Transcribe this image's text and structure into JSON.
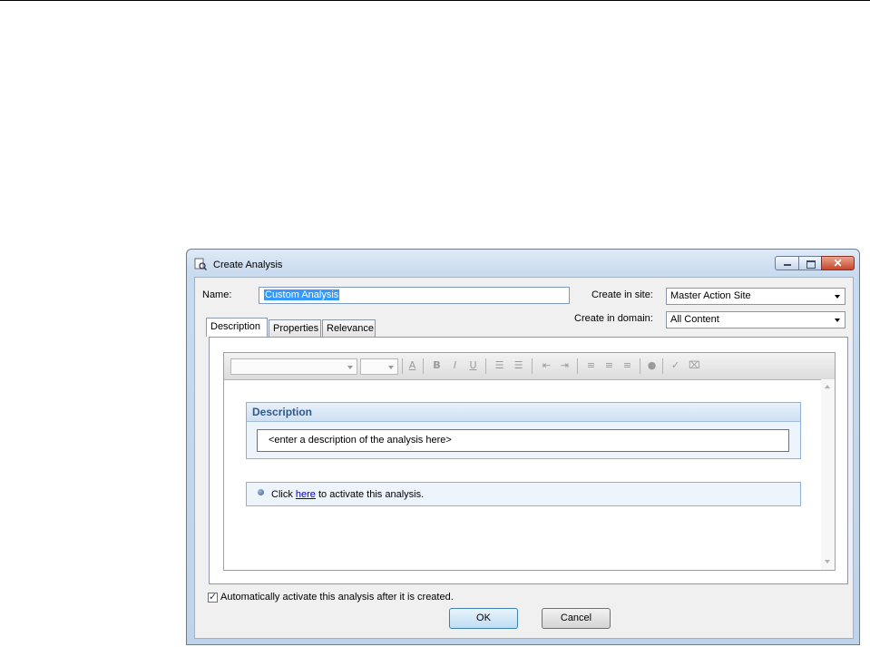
{
  "window": {
    "title": "Create Analysis",
    "close_glyph": "✕"
  },
  "form": {
    "name_label": "Name:",
    "name_value": "Custom Analysis",
    "site_label": "Create in site:",
    "site_value": "Master Action Site",
    "domain_label": "Create in domain:",
    "domain_value": "All Content"
  },
  "tabs": [
    {
      "label": "Description",
      "active": true
    },
    {
      "label": "Properties",
      "active": false
    },
    {
      "label": "Relevance",
      "active": false
    }
  ],
  "toolbar": {
    "icons": [
      "font-color-icon",
      "bold-icon",
      "italic-icon",
      "underline-icon",
      "numbered-list-icon",
      "bullet-list-icon",
      "outdent-icon",
      "indent-icon",
      "align-left-icon",
      "align-center-icon",
      "align-right-icon",
      "link-icon",
      "spellcheck-icon",
      "clear-format-icon"
    ],
    "glyphs": {
      "font_color": "A",
      "bold": "B",
      "italic": "I",
      "underline": "U",
      "numbered_list": "☰",
      "bullet_list": "☰",
      "outdent": "⇤",
      "indent": "⇥",
      "align_left": "≡",
      "align_center": "≡",
      "align_right": "≡",
      "link": "●",
      "spellcheck": "✓",
      "clear_format": "⌧"
    }
  },
  "editor": {
    "description_heading": "Description",
    "description_placeholder": "<enter a description of the analysis here>",
    "activate_prefix": "Click ",
    "activate_link": "here",
    "activate_suffix": " to activate this analysis."
  },
  "footer": {
    "auto_activate_label": "Automatically activate this analysis after it is created.",
    "auto_activate_checked": true,
    "ok_label": "OK",
    "cancel_label": "Cancel"
  }
}
